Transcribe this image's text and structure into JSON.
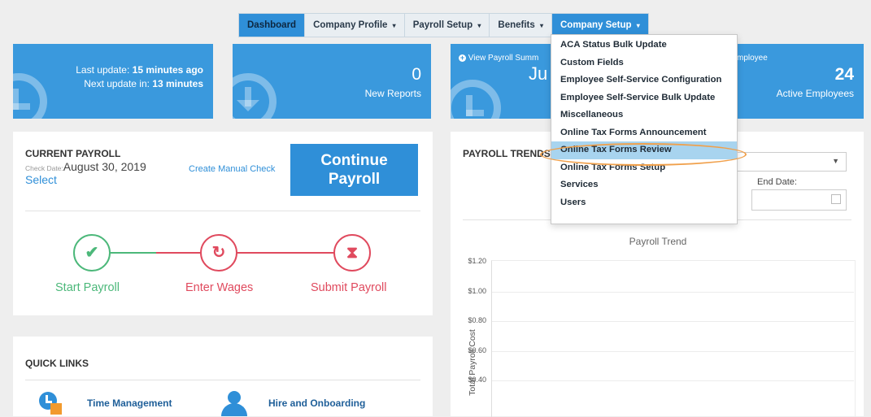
{
  "nav": {
    "tabs": [
      {
        "label": "Dashboard",
        "caret": ""
      },
      {
        "label": "Company Profile",
        "caret": "▾"
      },
      {
        "label": "Payroll Setup",
        "caret": "▾"
      },
      {
        "label": "Benefits",
        "caret": "▾"
      },
      {
        "label": "Company Setup",
        "caret": "▾"
      }
    ]
  },
  "cards": {
    "last_update_prefix": "Last update: ",
    "last_update_value": "15 minutes ago",
    "next_update_prefix": "Next update in: ",
    "next_update_value": "13 minutes",
    "new_reports_count": "0",
    "new_reports_label": "New Reports",
    "payroll_summary_link": "View Payroll Summ",
    "payroll_summary_value": "Ju",
    "employee_label": "mployee",
    "active_employees_count": "24",
    "active_employees_label": "Active Employees"
  },
  "current_payroll": {
    "title": "CURRENT PAYROLL",
    "check_date_label": "Check Date:",
    "check_date_value": "August 30, 2019",
    "select_link": "Select",
    "create_manual_check": "Create Manual Check",
    "continue_line1": "Continue",
    "continue_line2": "Payroll",
    "steps": [
      {
        "label": "Start Payroll",
        "icon": "check-icon",
        "color": "#4cb87a"
      },
      {
        "label": "Enter Wages",
        "icon": "refresh-icon",
        "color": "#e04a5e"
      },
      {
        "label": "Submit Payroll",
        "icon": "hourglass-icon",
        "color": "#e04a5e"
      }
    ]
  },
  "quick_links": {
    "title": "QUICK LINKS",
    "items": [
      {
        "label": "Time Management",
        "icon": "clock-icon"
      },
      {
        "label": "Hire and Onboarding",
        "icon": "person-icon"
      }
    ]
  },
  "payroll_trends": {
    "title": "PAYROLL TRENDS",
    "end_date_label": "End Date:"
  },
  "dropdown": {
    "items": [
      "ACA Status Bulk Update",
      "Custom Fields",
      "Employee Self-Service Configuration",
      "Employee Self-Service Bulk Update",
      "Miscellaneous",
      "Online Tax Forms Announcement",
      "Online Tax Forms Review",
      "Online Tax Forms Setup",
      "Services",
      "Users"
    ],
    "highlighted_index": 6
  },
  "chart_data": {
    "type": "line",
    "title": "Payroll Trend",
    "ylabel": "Total Payroll Cost",
    "xlabel": "",
    "y_ticks": [
      "$1.20",
      "$1.00",
      "$0.80",
      "$0.60",
      "$0.40"
    ],
    "grid": true,
    "series": []
  },
  "colors": {
    "brand_blue": "#3a99dd",
    "accent_green": "#4cb87a",
    "accent_red": "#e04a5e",
    "highlight_orange": "#f0a04b"
  }
}
